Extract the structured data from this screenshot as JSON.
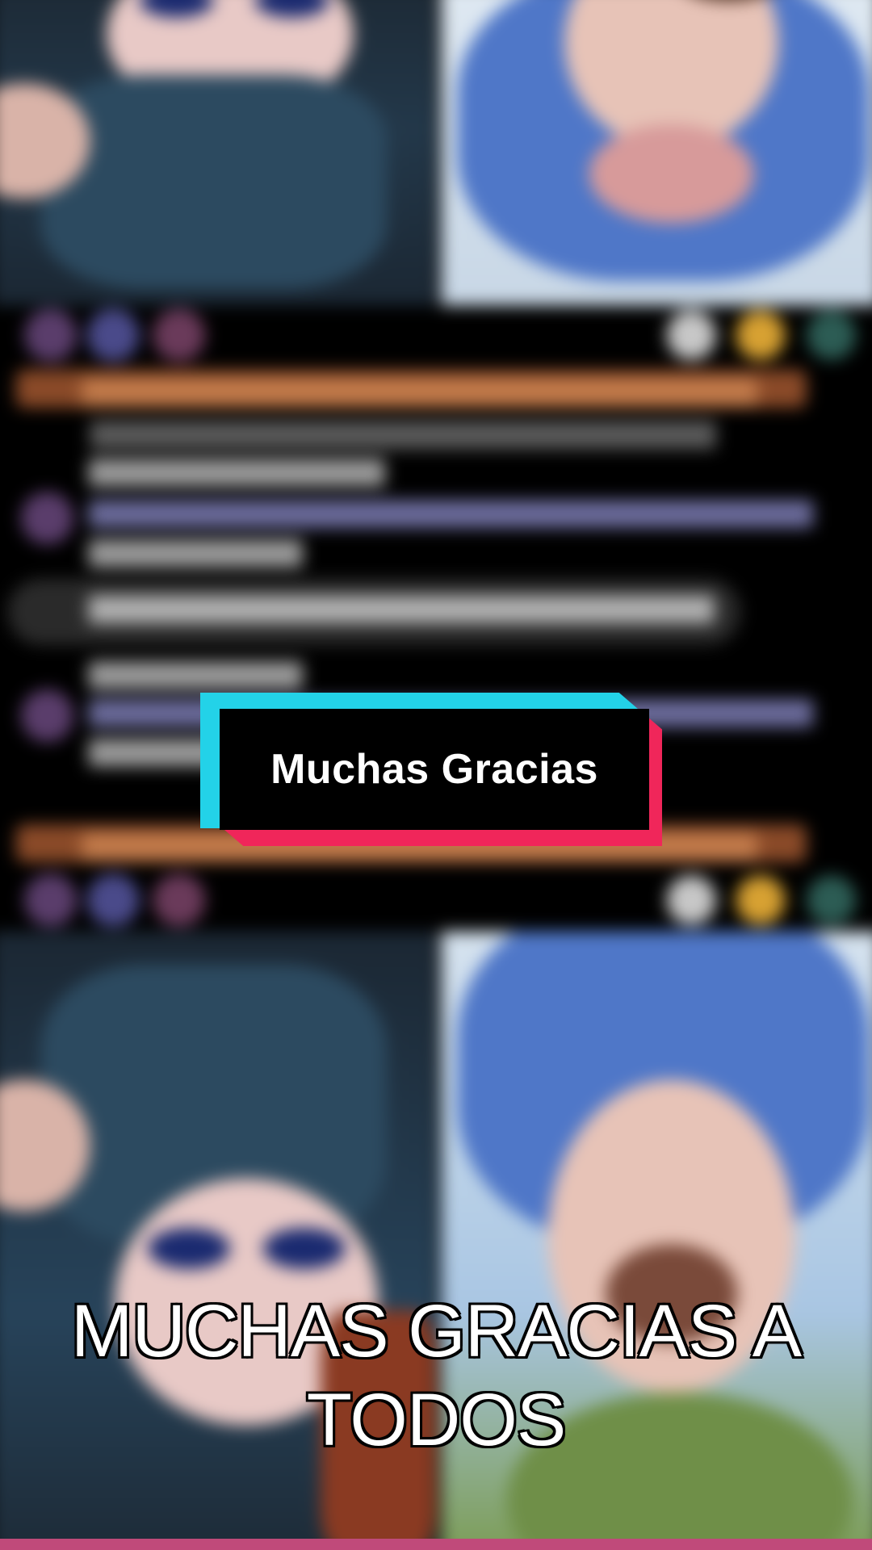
{
  "caption_card": {
    "text": "Muchas Gracias"
  },
  "subtitle": {
    "text": "MUCHAS GRACIAS A TODOS"
  },
  "colors": {
    "card_cyan": "#23d2e8",
    "card_pink": "#f0265a",
    "card_body": "#000000",
    "subtitle_fill": "#ffffff",
    "subtitle_stroke": "#000000"
  }
}
